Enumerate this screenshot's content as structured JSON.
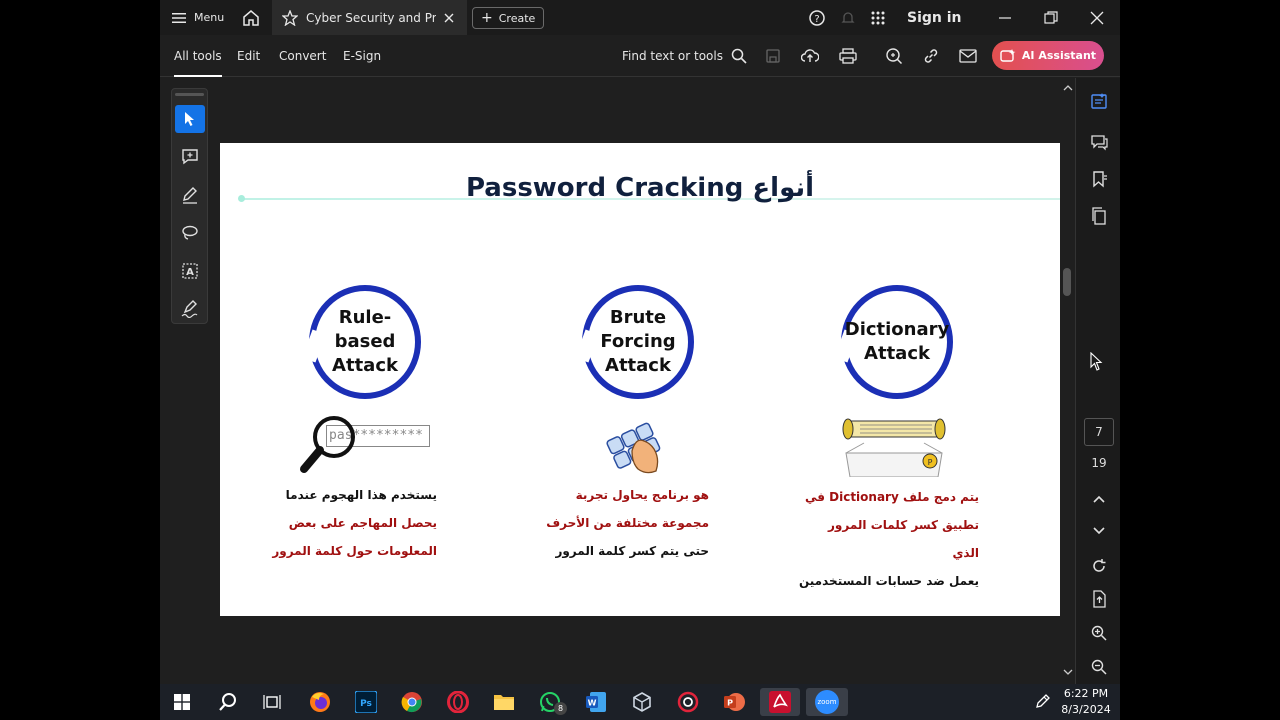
{
  "titlebar": {
    "menu_label": "Menu",
    "tab_title": "Cyber Security and Prep...",
    "create_label": "Create",
    "signin_label": "Sign in"
  },
  "toolbar": {
    "all_tools": "All tools",
    "edit": "Edit",
    "convert": "Convert",
    "esign": "E-Sign",
    "find": "Find text or tools",
    "ai_assistant": "AI Assistant"
  },
  "slide": {
    "title": "Password Cracking أنواع",
    "methods": [
      {
        "label_lines": [
          "Rule-based",
          "Attack"
        ],
        "desc": [
          "يستخدم هذا الهجوم عندما",
          "يحصل المهاجم على بعض",
          "المعلومات حول كلمة المرور"
        ],
        "icon_text": "pas*********"
      },
      {
        "label_lines": [
          "Brute",
          "Forcing",
          "Attack"
        ],
        "desc": [
          "هو برنامج يحاول تجربة",
          "مجموعة مختلفة من الأحرف",
          "حتى يتم كسر كلمة المرور"
        ]
      },
      {
        "label_lines": [
          "Dictionary",
          "Attack"
        ],
        "desc": [
          "يتم دمج ملف Dictionary في",
          "تطبيق كسر كلمات المرور الذي",
          "يعمل ضد حسابات المستخدمين"
        ]
      }
    ]
  },
  "navigation": {
    "current_page": "7",
    "total_pages": "19"
  },
  "taskbar": {
    "time": "6:22 PM",
    "date": "8/3/2024",
    "whatsapp_badge": "8",
    "zoom_label": "zoom"
  },
  "colors": {
    "accent": "#1473e6",
    "ring_blue": "#1b2fb5",
    "ai_gradient_start": "#e3504f",
    "ai_gradient_end": "#d94f8f",
    "desc_red": "#a01010"
  }
}
